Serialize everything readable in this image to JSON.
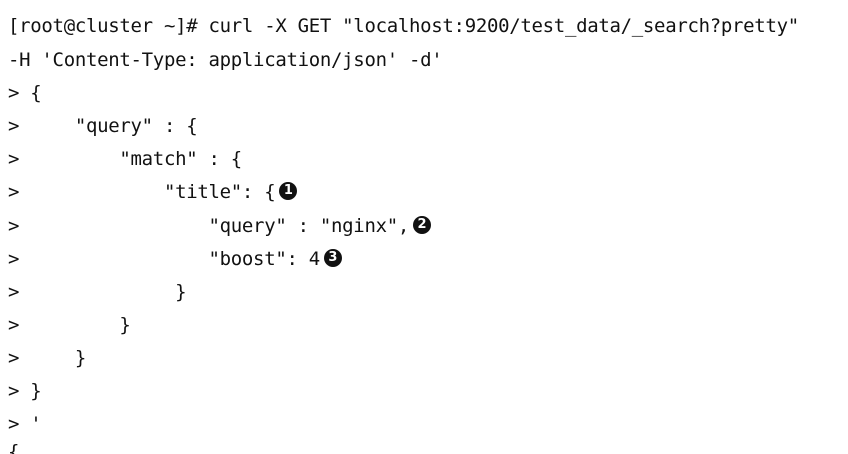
{
  "terminal": {
    "lines": [
      "[root@cluster ~]# curl -X GET \"localhost:9200/test_data/_search?pretty\"",
      "-H 'Content-Type: application/json' -d'",
      "> {",
      ">     \"query\" : {",
      ">         \"match\" : {",
      ">             \"title\": {",
      ">                 \"query\" : \"nginx\",",
      ">                 \"boost\": 4",
      ">              }",
      ">         }",
      ">     }",
      "> }",
      "> '",
      "{"
    ],
    "callouts": [
      "1",
      "2",
      "3"
    ]
  }
}
